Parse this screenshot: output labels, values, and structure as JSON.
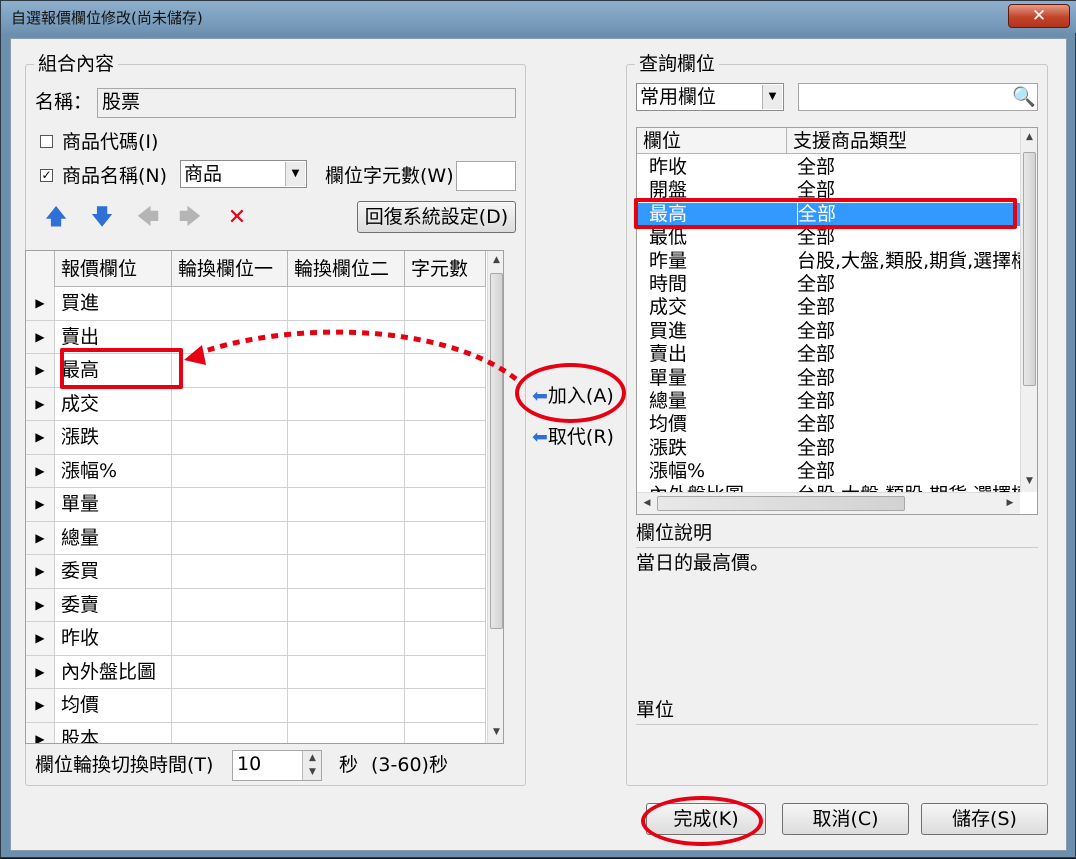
{
  "window": {
    "title": "自選報價欄位修改(尚未儲存)",
    "close_label": "✕"
  },
  "left_group": {
    "legend": "組合內容",
    "name_label": "名稱：",
    "name_value": "股票",
    "chk_code_label": "商品代碼(I)",
    "chk_code_checked": false,
    "chk_name_label": "商品名稱(N)",
    "chk_name_checked": true,
    "name_combo_value": "商品",
    "width_label": "欄位字元數(W)",
    "width_value": "",
    "restore_button": "回復系統設定(D)",
    "grid": {
      "headers": [
        "報價欄位",
        "輪換欄位一",
        "輪換欄位二",
        "字元數"
      ],
      "rows": [
        "買進",
        "賣出",
        "最高",
        "成交",
        "漲跌",
        "漲幅%",
        "單量",
        "總量",
        "委買",
        "委賣",
        "昨收",
        "內外盤比圖",
        "均價",
        "股本"
      ]
    },
    "rotate_label": "欄位輪換切換時間(T)",
    "rotate_value": "10",
    "rotate_unit": "秒",
    "rotate_range": "(3-60)秒"
  },
  "middle": {
    "add_button": "加入(A)",
    "replace_button": "取代(R)"
  },
  "right_group": {
    "legend": "查詢欄位",
    "filter_combo_value": "常用欄位",
    "search_value": "",
    "list": {
      "headers": [
        "欄位",
        "支援商品類型"
      ],
      "rows": [
        {
          "field": "昨收",
          "type": "全部"
        },
        {
          "field": "開盤",
          "type": "全部"
        },
        {
          "field": "最高",
          "type": "全部"
        },
        {
          "field": "最低",
          "type": "全部"
        },
        {
          "field": "昨量",
          "type": "台股,大盤,類股,期貨,選擇權"
        },
        {
          "field": "時間",
          "type": "全部"
        },
        {
          "field": "成交",
          "type": "全部"
        },
        {
          "field": "買進",
          "type": "全部"
        },
        {
          "field": "賣出",
          "type": "全部"
        },
        {
          "field": "單量",
          "type": "全部"
        },
        {
          "field": "總量",
          "type": "全部"
        },
        {
          "field": "均價",
          "type": "全部"
        },
        {
          "field": "漲跌",
          "type": "全部"
        },
        {
          "field": "漲幅%",
          "type": "全部"
        },
        {
          "field": "內外盤比圖",
          "type": "台股,大盤,類股,期貨,選擇權"
        }
      ],
      "selected_index": 2
    },
    "desc_label": "欄位說明",
    "desc_text": "當日的最高價。",
    "unit_label": "單位",
    "unit_text": ""
  },
  "footer": {
    "done_button": "完成(K)",
    "cancel_button": "取消(C)",
    "save_button": "儲存(S)"
  },
  "colors": {
    "highlight": "#e60012",
    "selection": "#3399ff",
    "arrow_up_down": "#2f6fd6"
  }
}
